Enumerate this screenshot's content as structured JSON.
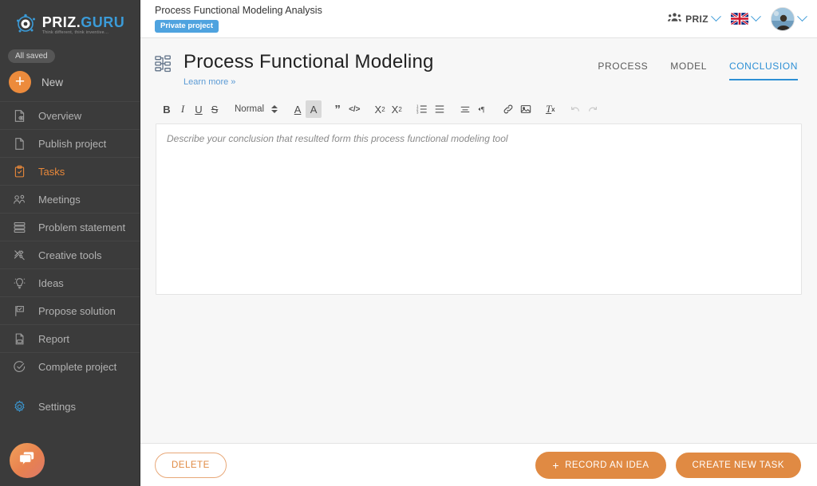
{
  "brand": {
    "name_primary": "PRIZ.",
    "name_secondary": "GURU",
    "tagline": "Think different, think inventive...",
    "accent_orange": "#e08a43",
    "accent_blue": "#2d8fd5"
  },
  "sidebar": {
    "saved_status": "All saved",
    "new_label": "New",
    "items": [
      {
        "label": "Overview",
        "icon": "document-eye-icon",
        "active": false
      },
      {
        "label": "Publish project",
        "icon": "page-icon",
        "active": false
      },
      {
        "label": "Tasks",
        "icon": "clipboard-check-icon",
        "active": true
      },
      {
        "label": "Meetings",
        "icon": "people-icon",
        "active": false
      },
      {
        "label": "Problem statement",
        "icon": "stack-icon",
        "active": false
      },
      {
        "label": "Creative tools",
        "icon": "tools-icon",
        "active": false
      },
      {
        "label": "Ideas",
        "icon": "lightbulb-icon",
        "active": false
      },
      {
        "label": "Propose solution",
        "icon": "flag-check-icon",
        "active": false
      },
      {
        "label": "Report",
        "icon": "pdf-icon",
        "active": false
      },
      {
        "label": "Complete project",
        "icon": "check-circle-icon",
        "active": false
      }
    ],
    "settings_label": "Settings",
    "settings_icon": "gear-icon",
    "chat_icon": "chat-bubbles-icon"
  },
  "topbar": {
    "project_name": "Process Functional Modeling Analysis",
    "project_visibility": "Private project",
    "team_name": "PRIZ",
    "team_icon": "people-group-icon",
    "language_icon": "uk-flag-icon",
    "avatar_icon": "user-avatar"
  },
  "page": {
    "title": "Process Functional Modeling",
    "title_icon": "hierarchy-diagram-icon",
    "learn_more": "Learn more »",
    "tabs": [
      {
        "label": "PROCESS",
        "active": false
      },
      {
        "label": "MODEL",
        "active": false
      },
      {
        "label": "CONCLUSION",
        "active": true
      }
    ]
  },
  "editor": {
    "placeholder": "Describe your conclusion that resulted form this process functional modeling tool",
    "value": "",
    "toolbar": {
      "bold": "B",
      "italic": "I",
      "underline": "U",
      "strike": "S",
      "block_format": "Normal",
      "text_color": "A",
      "highlight": "A",
      "blockquote": "”",
      "code": "</>",
      "subscript": "X",
      "subscript_n": "2",
      "superscript": "X",
      "superscript_n": "2",
      "ordered_list": "ordered-list-icon",
      "bullet_list": "bullet-list-icon",
      "align": "align-icon",
      "direction": "text-direction-icon",
      "link": "link-icon",
      "image": "image-icon",
      "clear_format": "T",
      "clear_format_x": "x",
      "undo": "undo-icon",
      "redo": "redo-icon"
    }
  },
  "footer": {
    "delete_label": "DELETE",
    "record_idea_label": "RECORD AN IDEA",
    "record_idea_plus": "+",
    "create_task_label": "CREATE NEW TASK"
  }
}
